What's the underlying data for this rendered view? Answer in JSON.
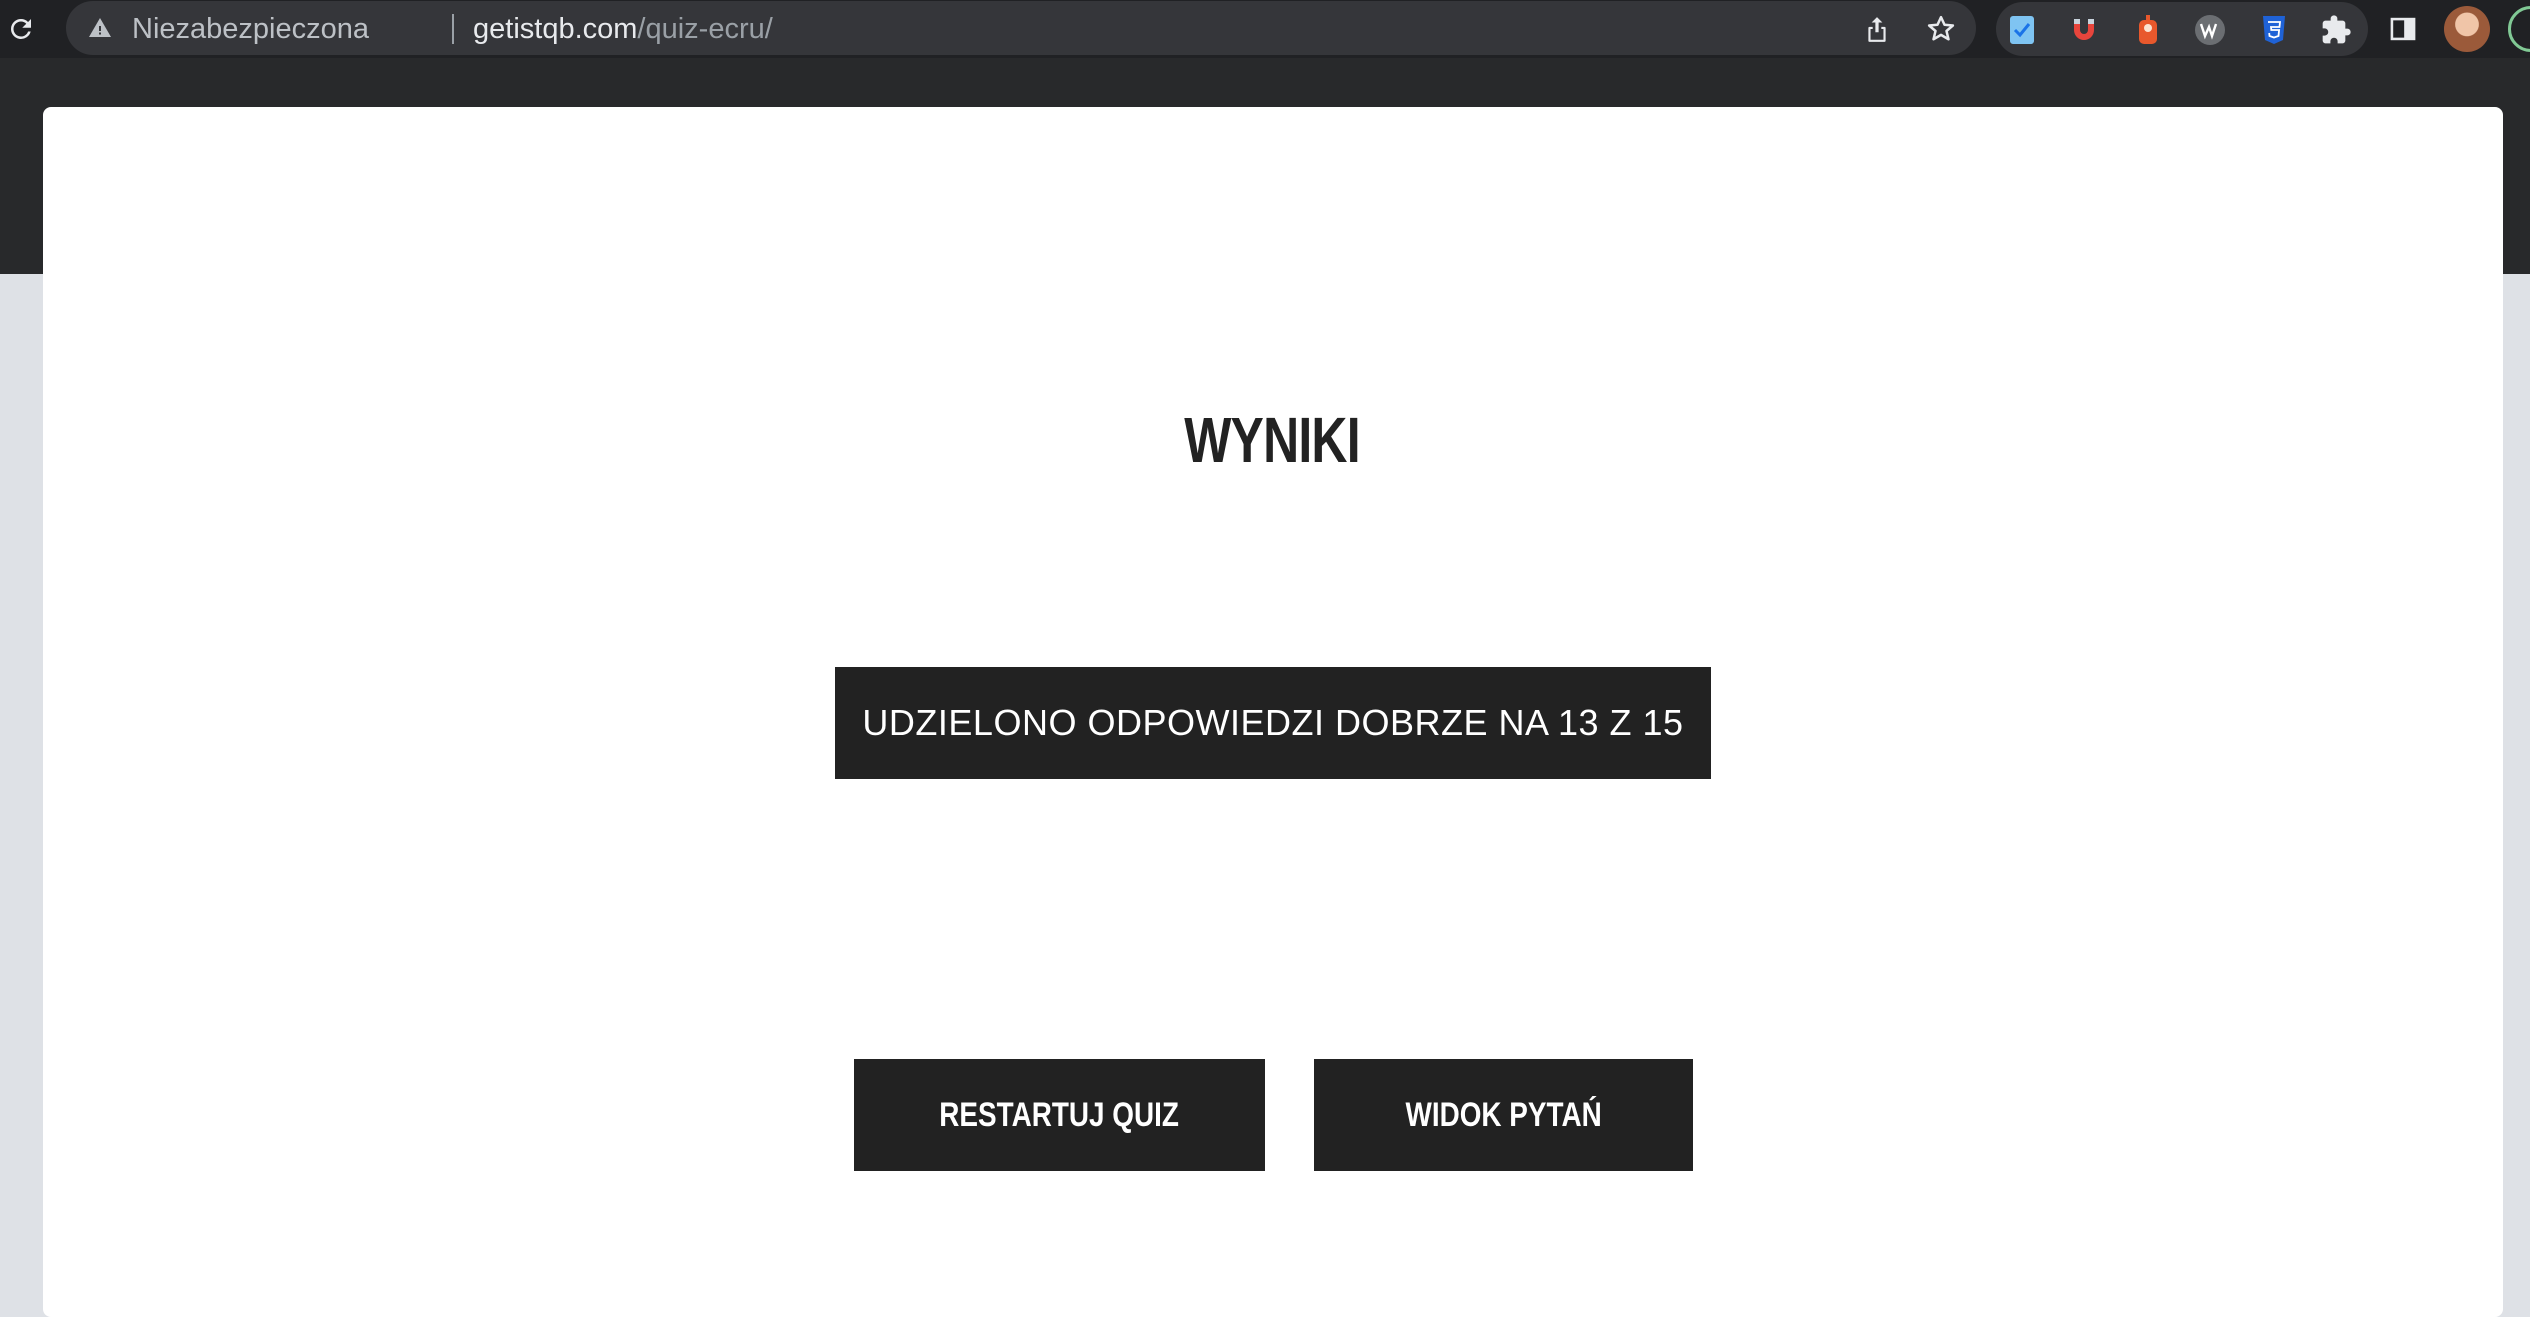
{
  "browser": {
    "security_label": "Niezabezpieczona",
    "url_host": "getistqb.com",
    "url_path": "/quiz-ecru/",
    "icons": [
      "reload-icon",
      "warning-icon",
      "share-icon",
      "bookmark-star-icon",
      "extensions-puzzle-icon",
      "side-panel-icon"
    ],
    "extensions": [
      "checklist-extension-icon",
      "magnet-extension-icon",
      "bot-extension-icon",
      "wv-extension-icon",
      "css-extension-icon"
    ]
  },
  "results": {
    "title": "WYNIKI",
    "score_text": "UDZIELONO ODPOWIEDZI DOBRZE NA 13 Z 15",
    "restart_label": "RESTARTUJ QUIZ",
    "view_questions_label": "WIDOK PYTAŃ"
  },
  "colors": {
    "chrome_bg": "#202124",
    "omnibox_bg": "#35363a",
    "header_bg": "#28292b",
    "button_bg": "#222222",
    "page_bg": "#dee1e6"
  }
}
